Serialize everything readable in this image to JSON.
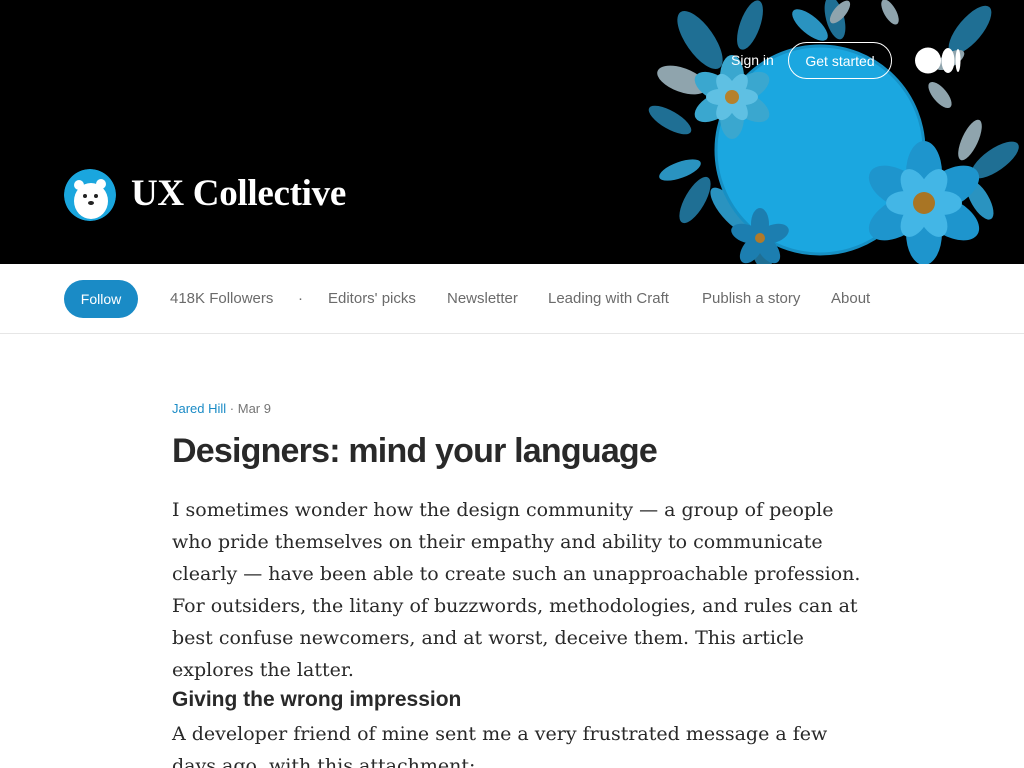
{
  "header": {
    "publication_name": "UX Collective",
    "sign_in_label": "Sign in",
    "get_started_label": "Get started",
    "logo_icon": "polar-bear-logo",
    "medium_icon": "medium-logo-icon"
  },
  "nav": {
    "follow_label": "Follow",
    "followers": "418K Followers",
    "separator": "·",
    "items": [
      "Editors' picks",
      "Newsletter",
      "Leading with Craft",
      "Publish a story",
      "About"
    ]
  },
  "article": {
    "author": "Jared Hill",
    "date": "Mar 9",
    "date_separator": " · ",
    "title": "Designers: mind your language",
    "paragraph1": "I sometimes wonder how the design community — a group of people who pride themselves on their empathy and ability to communicate clearly — have been able to create such an unapproachable profession. For outsiders, the litany of buzzwords, methodologies, and rules can at best confuse newcomers, and at worst, deceive them. This article explores the latter.",
    "subheading": "Giving the wrong impression",
    "paragraph2": "A developer friend of mine sent me a very frustrated message a few days ago, with this attachment:"
  },
  "colors": {
    "accent": "#1a8bc6",
    "banner_bg": "#000000",
    "text": "#292929",
    "muted": "#6b6b6b"
  }
}
